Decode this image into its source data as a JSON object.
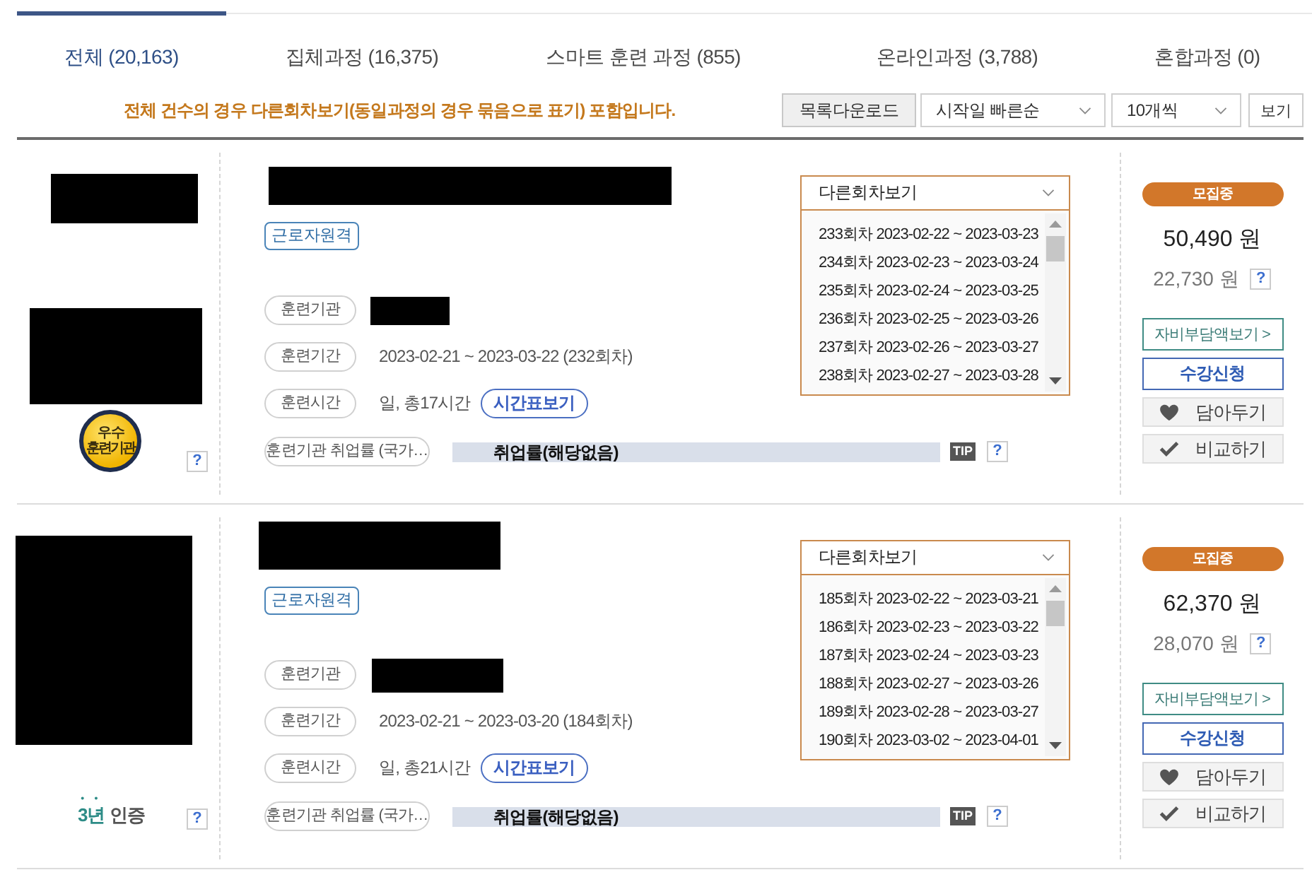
{
  "tabs": [
    {
      "label": "전체 (20,163)",
      "selected": true
    },
    {
      "label": "집체과정 (16,375)",
      "selected": false
    },
    {
      "label": "스마트 훈련 과정 (855)",
      "selected": false
    },
    {
      "label": "온라인과정 (3,788)",
      "selected": false
    },
    {
      "label": "혼합과정 (0)",
      "selected": false
    }
  ],
  "notice": "전체 건수의 경우 다른회차보기(동일과정의 경우 묶음으로 표기) 포함입니다.",
  "toolbar": {
    "download_button": "목록다운로드",
    "sort_select": "시작일 빠른순",
    "page_size_select": "10개씩",
    "view_button": "보기"
  },
  "courses": [
    {
      "institution": {
        "name_redacted": true,
        "logo_redacted": true,
        "badge": {
          "kind": "excellent",
          "lines": [
            "우 수",
            "훈련기관"
          ]
        },
        "help": "?"
      },
      "title_redacted": true,
      "tag": "근로자원격",
      "details": [
        {
          "kind": "redacted",
          "label": "훈련기관"
        },
        {
          "kind": "text",
          "label": "훈련기간",
          "value": "2023-02-21 ~ 2023-03-22 (232회차)"
        },
        {
          "kind": "text_button",
          "label": "훈련시간",
          "value": "일, 총17시간",
          "button": "시간표보기"
        }
      ],
      "employment": {
        "label": "훈련기관 취업률 (국가…",
        "bar_text": "취업률(해당없음)",
        "tip": "TIP",
        "help": "?"
      },
      "sessions": {
        "header": "다른회차보기",
        "items": [
          "233회차 2023-02-22 ~ 2023-03-23",
          "234회차 2023-02-23 ~ 2023-03-24",
          "235회차 2023-02-24 ~ 2023-03-25",
          "236회차 2023-02-25 ~ 2023-03-26",
          "237회차 2023-02-26 ~ 2023-03-27",
          "238회차 2023-02-27 ~ 2023-03-28"
        ]
      },
      "status": "모집중",
      "price": "50,490 원",
      "self_pay": "22,730 원",
      "price_help": "?",
      "actions": [
        {
          "kind": "cost",
          "label": "자비부담액보기 >"
        },
        {
          "kind": "apply",
          "label": "수강신청"
        },
        {
          "kind": "save",
          "label": "담아두기"
        },
        {
          "kind": "compare",
          "label": "비교하기"
        }
      ]
    },
    {
      "institution": {
        "name_redacted": false,
        "logo_redacted": true,
        "badge": {
          "kind": "certified",
          "years": "3년",
          "label": "인증"
        },
        "help": "?"
      },
      "title_redacted": true,
      "tag": "근로자원격",
      "details": [
        {
          "kind": "redacted",
          "label": "훈련기관"
        },
        {
          "kind": "text",
          "label": "훈련기간",
          "value": "2023-02-21 ~ 2023-03-20 (184회차)"
        },
        {
          "kind": "text_button",
          "label": "훈련시간",
          "value": "일, 총21시간",
          "button": "시간표보기"
        }
      ],
      "employment": {
        "label": "훈련기관 취업률 (국가…",
        "bar_text": "취업률(해당없음)",
        "tip": "TIP",
        "help": "?"
      },
      "sessions": {
        "header": "다른회차보기",
        "items": [
          "185회차 2023-02-22 ~ 2023-03-21",
          "186회차 2023-02-23 ~ 2023-03-22",
          "187회차 2023-02-24 ~ 2023-03-23",
          "188회차 2023-02-27 ~ 2023-03-26",
          "189회차 2023-02-28 ~ 2023-03-27",
          "190회차 2023-03-02 ~ 2023-04-01"
        ]
      },
      "status": "모집중",
      "price": "62,370 원",
      "self_pay": "28,070 원",
      "price_help": "?",
      "actions": [
        {
          "kind": "cost",
          "label": "자비부담액보기 >"
        },
        {
          "kind": "apply",
          "label": "수강신청"
        },
        {
          "kind": "save",
          "label": "담아두기"
        },
        {
          "kind": "compare",
          "label": "비교하기"
        }
      ]
    }
  ]
}
